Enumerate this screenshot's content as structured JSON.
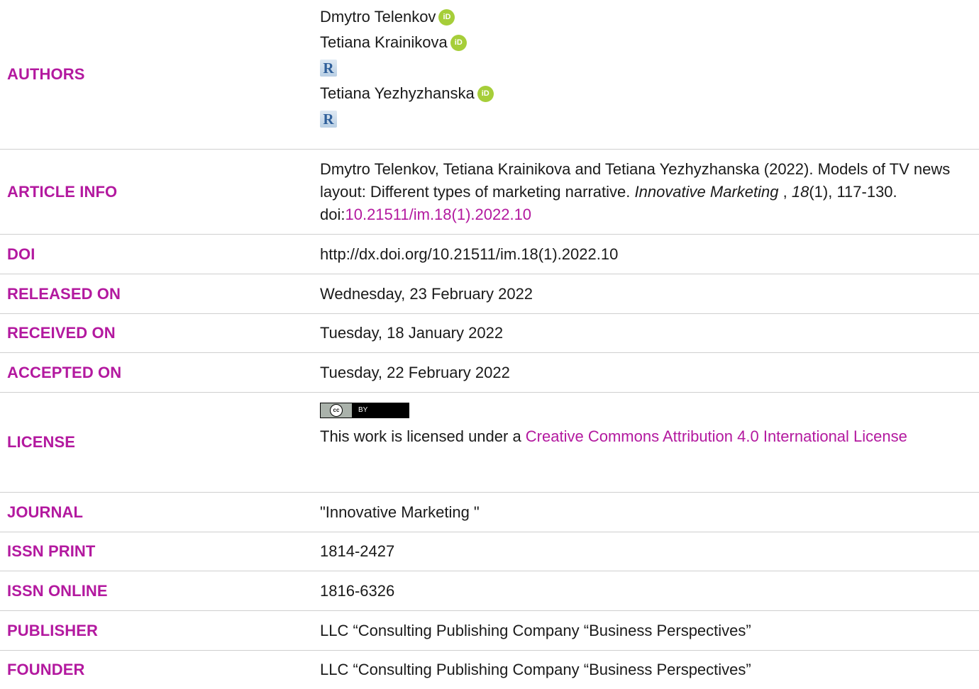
{
  "authors": {
    "label": "AUTHORS",
    "list": [
      {
        "name": "Dmytro Telenkov",
        "orcid": "iD",
        "researcher": false
      },
      {
        "name": "Tetiana Krainikova",
        "orcid": "iD",
        "researcher": true
      },
      {
        "name": "Tetiana Yezhyzhanska",
        "orcid": "iD",
        "researcher": true
      }
    ],
    "researcher_glyph": "R"
  },
  "article_info": {
    "label": "ARTICLE INFO",
    "citation_text": "Dmytro Telenkov, Tetiana Krainikova and Tetiana Yezhyzhanska (2022). Models of TV news layout: Different types of marketing narrative.",
    "journal_italic": "Innovative Marketing",
    "after_journal": " ,",
    "volume_italic": "18",
    "issue_pages": "(1), 117-130. doi:",
    "doi_link": "10.21511/im.18(1).2022.10"
  },
  "doi": {
    "label": "DOI",
    "value": "http://dx.doi.org/10.21511/im.18(1).2022.10"
  },
  "released_on": {
    "label": "RELEASED ON",
    "value": "Wednesday, 23 February 2022"
  },
  "received_on": {
    "label": "RECEIVED ON",
    "value": "Tuesday, 18 January 2022"
  },
  "accepted_on": {
    "label": "ACCEPTED ON",
    "value": "Tuesday, 22 February 2022"
  },
  "license": {
    "label": "LICENSE",
    "badge_left": "cc",
    "badge_right": "BY",
    "text": "This work is licensed under a ",
    "link": "Creative Commons Attribution 4.0 International License"
  },
  "journal": {
    "label": "JOURNAL",
    "value": "\"Innovative Marketing \""
  },
  "issn_print": {
    "label": "ISSN PRINT",
    "value": "1814-2427"
  },
  "issn_online": {
    "label": "ISSN ONLINE",
    "value": "1816-6326"
  },
  "publisher": {
    "label": "PUBLISHER",
    "value": "LLC “Consulting Publishing Company “Business Perspectives”"
  },
  "founder": {
    "label": "FOUNDER",
    "value": "LLC “Consulting Publishing Company “Business Perspectives”"
  },
  "colors": {
    "accent": "#b3199f",
    "orcid": "#a6ce39",
    "divider": "#cfcfcf"
  }
}
